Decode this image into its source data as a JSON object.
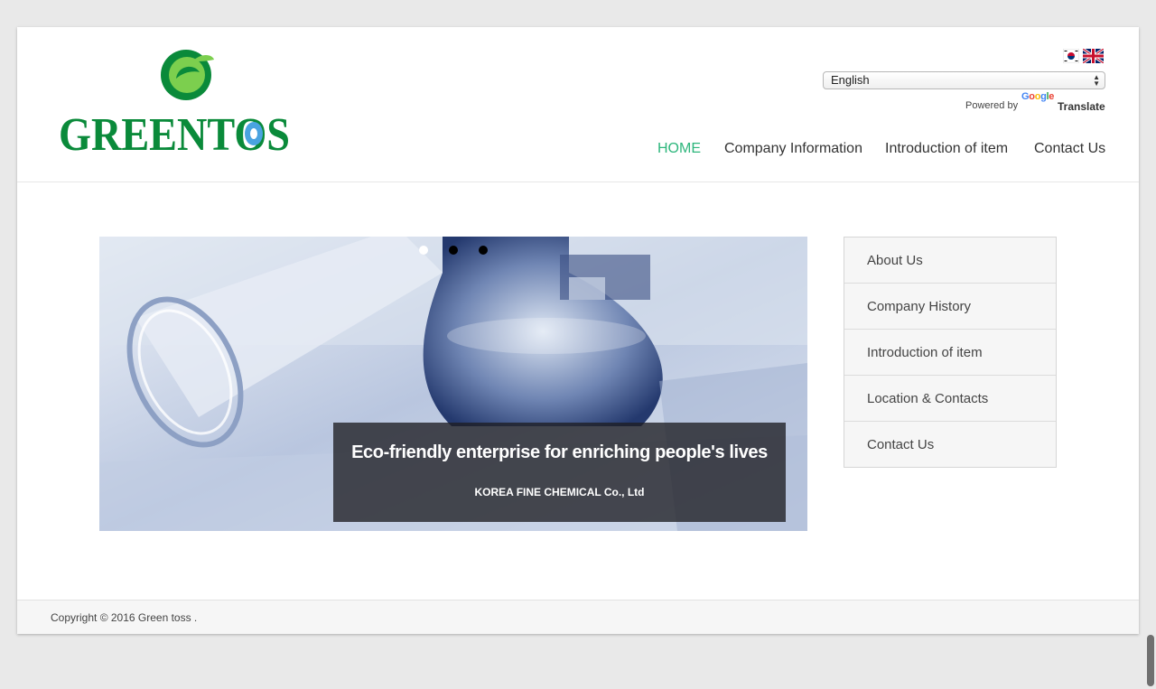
{
  "brand": {
    "name": "GREENTOS",
    "accent": "#2db67c",
    "logo_green": "#0a8a3a"
  },
  "language": {
    "flags": [
      "korean-flag-icon",
      "uk-flag-icon"
    ],
    "selected": "English",
    "powered_by": "Powered by",
    "google": "Google",
    "translate": "Translate"
  },
  "nav": {
    "items": [
      {
        "label": "HOME",
        "active": true
      },
      {
        "label": "Company Information",
        "active": false
      },
      {
        "label": "Introduction of item",
        "active": false
      },
      {
        "label": "Contact Us",
        "active": false
      }
    ]
  },
  "slider": {
    "dots": 3,
    "active_dot": 0,
    "title": "Eco-friendly enterprise for enriching people's lives",
    "subtitle": "KOREA FINE CHEMICAL Co., Ltd"
  },
  "sidebar": {
    "items": [
      {
        "label": "About Us"
      },
      {
        "label": "Company History"
      },
      {
        "label": "Introduction of item"
      },
      {
        "label": "Location & Contacts"
      },
      {
        "label": "Contact Us"
      }
    ]
  },
  "footer": {
    "copyright": "Copyright © 2016 Green toss ."
  }
}
